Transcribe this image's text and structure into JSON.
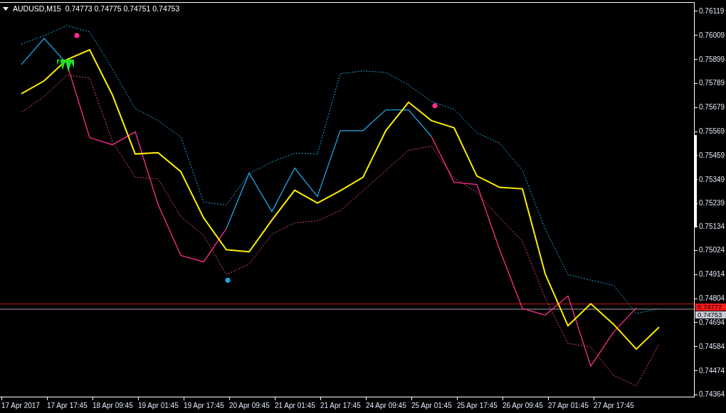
{
  "header": {
    "symbol": "AUDUSD,M15",
    "quotes": "0.74773 0.74775 0.74751 0.74753"
  },
  "chart": {
    "chart_data": {
      "type": "line",
      "categories": [
        "17 Apr 2017",
        null,
        "17 Apr 17:45",
        null,
        "18 Apr 09:45",
        null,
        "19 Apr 01:45",
        null,
        "19 Apr 17:45",
        null,
        "20 Apr 09:45",
        null,
        "21 Apr 01:45",
        null,
        "21 Apr 17:45",
        null,
        "24 Apr 09:45",
        null,
        "25 Apr 01:45",
        null,
        "25 Apr 17:45",
        null,
        "26 Apr 09:45",
        null,
        "27 Apr 01:45",
        null,
        "27 Apr 17:45",
        null,
        null,
        null
      ],
      "ylim": [
        0.74352,
        0.76158
      ],
      "yticks": [
        0.76119,
        0.76009,
        0.75899,
        0.75789,
        0.75679,
        0.75569,
        0.75459,
        0.75349,
        0.75239,
        0.75134,
        0.75024,
        0.74914,
        0.74804,
        0.74694,
        0.74584,
        0.74474,
        0.74364
      ],
      "series": [
        {
          "color": "#1fa8e0",
          "line_style": "dashed",
          "values": [
            0.75969,
            0.76008,
            0.76054,
            0.76025,
            0.75855,
            0.75673,
            0.75618,
            0.75543,
            0.75244,
            0.75231,
            0.75374,
            0.75429,
            0.75468,
            0.75465,
            0.75833,
            0.75846,
            0.75839,
            0.75781,
            0.75706,
            0.7567,
            0.75562,
            0.75514,
            0.7539,
            0.7512,
            0.74912,
            0.74886,
            0.74863,
            0.74733,
            0.74756,
            null
          ]
        },
        {
          "color": "#e04a7a",
          "line_style": "dashed",
          "values": [
            0.75657,
            0.75728,
            0.75826,
            0.75813,
            0.75523,
            0.75358,
            0.75351,
            0.75178,
            0.75091,
            0.74912,
            0.7496,
            0.75097,
            0.75149,
            0.75159,
            0.75205,
            0.75296,
            0.7539,
            0.75481,
            0.75501,
            0.75354,
            0.75289,
            0.75172,
            0.75065,
            0.74804,
            0.74596,
            0.7458,
            0.7445,
            0.74401,
            0.74593,
            null
          ]
        },
        {
          "color": "#1ea7e8",
          "values": [
            0.75875,
            0.75995,
            0.75878,
            null,
            null,
            null,
            null,
            null,
            null,
            0.75123,
            0.75377,
            0.75201,
            0.754,
            0.7527,
            0.75572,
            0.75572,
            0.75667,
            0.75667,
            0.75546,
            null,
            null,
            null,
            null,
            null,
            null,
            null,
            null,
            null,
            null,
            null
          ]
        },
        {
          "color": "#ff2d8f",
          "values": [
            null,
            null,
            0.75878,
            0.7554,
            0.75507,
            0.75566,
            0.75234,
            0.75,
            0.7497,
            0.75123,
            null,
            null,
            null,
            null,
            null,
            null,
            null,
            null,
            0.75546,
            0.75335,
            0.75325,
            0.75026,
            0.74756,
            0.74726,
            0.74814,
            0.74492,
            0.74648,
            0.74759,
            null,
            null
          ]
        },
        {
          "color": "#ffee00",
          "values": [
            0.75741,
            0.758,
            0.75898,
            0.75943,
            0.75735,
            0.75465,
            0.75471,
            0.75384,
            0.75172,
            0.75026,
            0.75016,
            0.75162,
            0.75299,
            0.7524,
            0.75296,
            0.75358,
            0.75572,
            0.75702,
            0.75618,
            0.75585,
            0.75364,
            0.75312,
            0.75305,
            0.74915,
            0.74677,
            0.74778,
            0.74684,
            0.7457,
            0.74671,
            null
          ]
        }
      ],
      "ref_lines": [
        {
          "axis": "y",
          "value": 0.74777,
          "label": "0.74777",
          "color": "#ff1a1a"
        },
        {
          "axis": "y",
          "value": 0.74753,
          "label": "0.74753",
          "color": "#c8ccd4"
        }
      ]
    }
  }
}
